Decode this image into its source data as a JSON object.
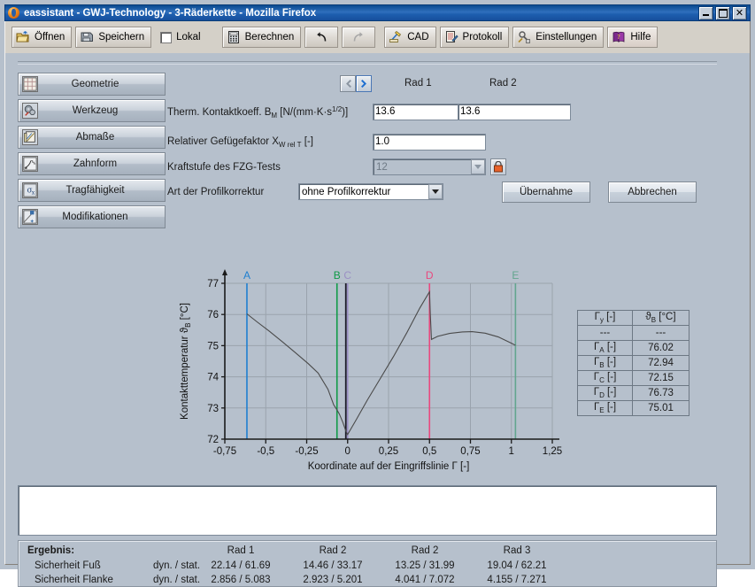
{
  "window": {
    "title": "eassistant - GWJ-Technology - 3-Räderkette - Mozilla Firefox",
    "icon": "firefox-icon",
    "minimize_label": "_",
    "maximize_label": "□",
    "close_label": "X"
  },
  "toolbar": {
    "items": [
      {
        "label": "Öffnen",
        "icon": "open-folder-icon",
        "type": "button",
        "enabled": true
      },
      {
        "label": "Speichern",
        "icon": "floppy-disk-icon",
        "type": "button",
        "enabled": true
      },
      {
        "label": "Lokal",
        "icon": "checkbox-icon",
        "type": "checkbox",
        "checked": false
      },
      {
        "label": "Berechnen",
        "icon": "calculator-icon",
        "type": "button",
        "enabled": true
      },
      {
        "label": "",
        "icon": "undo-arrow-icon",
        "type": "button",
        "enabled": true
      },
      {
        "label": "",
        "icon": "redo-arrow-icon",
        "type": "button",
        "enabled": false
      },
      {
        "label": "CAD",
        "icon": "cad-pencil-icon",
        "type": "button",
        "enabled": true
      },
      {
        "label": "Protokoll",
        "icon": "document-pen-icon",
        "type": "button",
        "enabled": true
      },
      {
        "label": "Einstellungen",
        "icon": "wrench-gear-icon",
        "type": "button",
        "enabled": true
      },
      {
        "label": "Hilfe",
        "icon": "help-book-icon",
        "type": "button",
        "enabled": true
      }
    ]
  },
  "sidebar": {
    "items": [
      {
        "label": "Geometrie",
        "icon": "grid-icon"
      },
      {
        "label": "Werkzeug",
        "icon": "gears-icon"
      },
      {
        "label": "Abmaße",
        "icon": "ruler-sheet-icon"
      },
      {
        "label": "Zahnform",
        "icon": "tooth-profile-icon"
      },
      {
        "label": "Tragfähigkeit",
        "icon": "sigma-x-icon"
      },
      {
        "label": "Modifikationen",
        "icon": "modification-icon"
      }
    ]
  },
  "form": {
    "prev_label": "◀",
    "next_label": "▶",
    "column_headers": [
      "Rad 1",
      "Rad 2"
    ],
    "rows": [
      {
        "label_prefix": "Therm. Kontaktkoeff. B",
        "label_sub": "M",
        "label_mid": " [N/(mm·K·s",
        "label_sup": "1/2",
        "label_suffix": ")]",
        "value1": "13.6",
        "value2": "13.6"
      },
      {
        "label_prefix": "Relativer Gefügefaktor X",
        "label_sub": "W rel T",
        "label_suffix": " [-]",
        "value1": "1.0"
      },
      {
        "label": "Kraftstufe des FZG-Tests",
        "value": "12",
        "disabled": true,
        "lock_icon": "lock-icon"
      },
      {
        "label": "Art der Profilkorrektur",
        "value": "ohne Profilkorrektur"
      }
    ],
    "apply_label": "Übernahme",
    "cancel_label": "Abbrechen"
  },
  "chart_data": {
    "type": "line",
    "title": "",
    "xlabel": "Koordinate auf der Eingriffslinie Γ [-]",
    "ylabel": "Kontakttemperatur ϑ_B [°C]",
    "xlim": [
      -0.75,
      1.25
    ],
    "ylim": [
      72,
      77
    ],
    "xticks": [
      -0.75,
      -0.5,
      -0.25,
      0,
      0.25,
      0.5,
      0.75,
      1,
      1.25
    ],
    "xtick_labels": [
      "-0,75",
      "-0,5",
      "-0,25",
      "0",
      "0,25",
      "0,5",
      "0,75",
      "1",
      "1,25"
    ],
    "yticks": [
      72,
      73,
      74,
      75,
      76,
      77
    ],
    "ytick_labels": [
      "72",
      "73",
      "74",
      "75",
      "76",
      "77"
    ],
    "grid": true,
    "legend": "none",
    "series": [
      {
        "name": "Kontakttemperatur",
        "color": "#4a4a4a",
        "points": [
          [
            -0.615,
            76.02
          ],
          [
            -0.55,
            75.75
          ],
          [
            -0.48,
            75.47
          ],
          [
            -0.4,
            75.13
          ],
          [
            -0.32,
            74.78
          ],
          [
            -0.24,
            74.42
          ],
          [
            -0.18,
            74.12
          ],
          [
            -0.12,
            73.6
          ],
          [
            -0.085,
            73.1
          ],
          [
            -0.065,
            72.94
          ],
          [
            -0.05,
            72.8
          ],
          [
            -0.03,
            72.55
          ],
          [
            -0.01,
            72.25
          ],
          [
            0.0,
            72.15
          ],
          [
            0.05,
            72.6
          ],
          [
            0.12,
            73.25
          ],
          [
            0.2,
            73.95
          ],
          [
            0.28,
            74.65
          ],
          [
            0.36,
            75.4
          ],
          [
            0.44,
            76.2
          ],
          [
            0.5,
            76.73
          ],
          [
            0.505,
            76.0
          ],
          [
            0.512,
            75.2
          ],
          [
            0.55,
            75.3
          ],
          [
            0.62,
            75.39
          ],
          [
            0.7,
            75.44
          ],
          [
            0.76,
            75.45
          ],
          [
            0.84,
            75.4
          ],
          [
            0.92,
            75.28
          ],
          [
            1.0,
            75.08
          ],
          [
            1.025,
            75.01
          ]
        ]
      }
    ],
    "markers": [
      {
        "label": "A",
        "x": -0.615,
        "color": "#1f7fd0"
      },
      {
        "label": "B",
        "x": -0.065,
        "color": "#0f9a47"
      },
      {
        "label": "C",
        "x": 0.0,
        "color": "#9b8fc4"
      },
      {
        "label": "D",
        "x": 0.5,
        "color": "#e9487e"
      },
      {
        "label": "E",
        "x": 1.025,
        "color": "#63a58e"
      }
    ]
  },
  "results_table": {
    "headers": [
      "Γy [-]",
      "ϑB [°C]"
    ],
    "header_cells": [
      {
        "sym": "Γ",
        "sub": "y",
        "unit": " [-]"
      },
      {
        "sym": "ϑ",
        "sub": "B",
        "unit": " [°C]"
      }
    ],
    "rows": [
      {
        "key": "---",
        "sub": "",
        "value": "---"
      },
      {
        "key": "Γ",
        "sub": "A",
        "unit": " [-]",
        "value": "76.02"
      },
      {
        "key": "Γ",
        "sub": "B",
        "unit": " [-]",
        "value": "72.94"
      },
      {
        "key": "Γ",
        "sub": "C",
        "unit": " [-]",
        "value": "72.15"
      },
      {
        "key": "Γ",
        "sub": "D",
        "unit": " [-]",
        "value": "76.73"
      },
      {
        "key": "Γ",
        "sub": "E",
        "unit": " [-]",
        "value": "75.01"
      }
    ]
  },
  "message_panel": {
    "text": ""
  },
  "results": {
    "title": "Ergebnis:",
    "columns": [
      "Rad 1",
      "Rad 2",
      "Rad 2",
      "Rad 3"
    ],
    "rows": [
      {
        "label": "Sicherheit Fuß",
        "sublabel": "dyn. / stat.",
        "values": [
          "22.14  /  61.69",
          "14.46  /  33.17",
          "13.25  /  31.99",
          "19.04  /  62.21"
        ]
      },
      {
        "label": "Sicherheit Flanke",
        "sublabel": "dyn. / stat.",
        "values": [
          "2.856  /  5.083",
          "2.923  /  5.201",
          "4.041  /  7.072",
          "4.155  /  7.271"
        ]
      }
    ]
  },
  "colors": {
    "titlebar": "#1d5eae",
    "panel_bg": "#b6c0cc",
    "toolbar_bg": "#d4d0c8",
    "field_bg": "#ffffff"
  }
}
